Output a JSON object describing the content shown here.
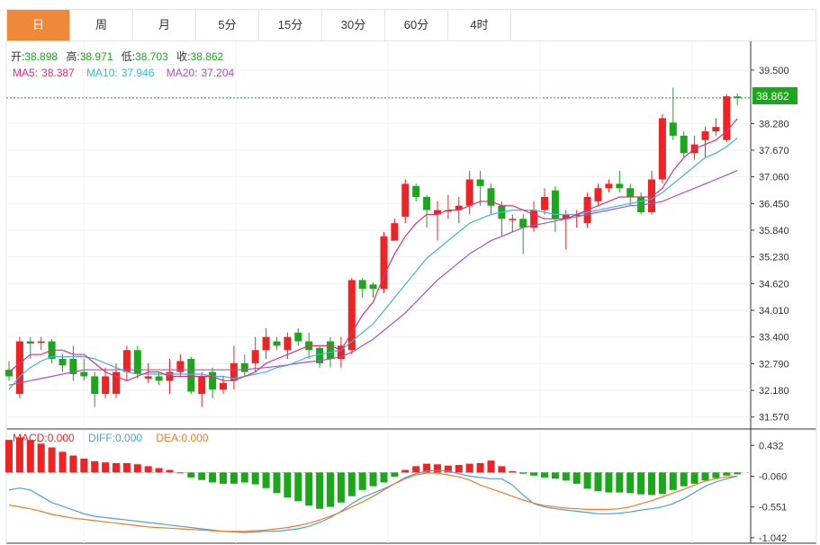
{
  "tabs": [
    "日",
    "周",
    "月",
    "5分",
    "15分",
    "30分",
    "60分",
    "4时"
  ],
  "active_tab": 0,
  "ohlc": {
    "open_label": "开:",
    "open": "38.898",
    "high_label": "高:",
    "high": "38.971",
    "low_label": "低:",
    "low": "38.703",
    "close_label": "收:",
    "close": "38.862"
  },
  "ma": {
    "ma5_label": "MA5:",
    "ma5": "38.387",
    "ma10_label": "MA10:",
    "ma10": "37.946",
    "ma20_label": "MA20:",
    "ma20": "37.204"
  },
  "macd_header": {
    "macd_label": "MACD:",
    "macd": "0.000",
    "diff_label": "DIFF:",
    "diff": "0.000",
    "dea_label": "DEA:",
    "dea": "0.000"
  },
  "last_price_tag": "38.862",
  "colors": {
    "up": "#ee2424",
    "down": "#1aa81a",
    "ma5": "#e0307a",
    "ma10": "#3bb8d8",
    "ma20": "#b050c0",
    "diff": "#4aa0e0",
    "dea": "#f07d23",
    "accent": "#f0883a"
  },
  "chart_data": [
    {
      "type": "candlestick",
      "y_ticks": [
        39.5,
        38.28,
        37.67,
        37.06,
        36.45,
        35.84,
        35.23,
        34.62,
        34.01,
        33.4,
        32.79,
        32.18,
        31.57
      ],
      "y_tick_labels": [
        "39.500",
        "38.280",
        "37.670",
        "37.060",
        "36.450",
        "35.840",
        "35.230",
        "34.620",
        "34.010",
        "33.400",
        "32.790",
        "32.180",
        "31.570"
      ],
      "ylim": [
        31.4,
        39.95
      ],
      "candles": [
        [
          32.65,
          32.5,
          32.85,
          32.4
        ],
        [
          32.1,
          33.3,
          33.4,
          32.0
        ],
        [
          33.3,
          33.25,
          33.4,
          32.9
        ],
        [
          33.3,
          33.3,
          33.4,
          33.1
        ],
        [
          33.3,
          32.9,
          33.35,
          32.8
        ],
        [
          32.9,
          32.75,
          33.0,
          32.6
        ],
        [
          32.9,
          32.55,
          33.2,
          32.4
        ],
        [
          32.6,
          32.5,
          32.9,
          32.4
        ],
        [
          32.5,
          32.1,
          32.6,
          31.8
        ],
        [
          32.1,
          32.5,
          32.7,
          32.0
        ],
        [
          32.1,
          32.6,
          32.8,
          32.0
        ],
        [
          32.6,
          33.1,
          33.2,
          32.4
        ],
        [
          33.1,
          32.55,
          33.2,
          32.45
        ],
        [
          32.45,
          32.5,
          32.8,
          32.35
        ],
        [
          32.5,
          32.4,
          32.6,
          32.3
        ],
        [
          32.4,
          32.6,
          32.9,
          32.1
        ],
        [
          32.6,
          32.85,
          33.0,
          32.5
        ],
        [
          32.9,
          32.15,
          32.95,
          32.1
        ],
        [
          32.1,
          32.5,
          32.6,
          31.8
        ],
        [
          32.6,
          32.2,
          32.7,
          32.0
        ],
        [
          32.2,
          32.35,
          32.5,
          32.1
        ],
        [
          32.4,
          32.8,
          33.2,
          32.2
        ],
        [
          32.8,
          32.6,
          33.0,
          32.5
        ],
        [
          32.8,
          33.1,
          33.4,
          32.6
        ],
        [
          33.1,
          33.4,
          33.6,
          32.9
        ],
        [
          33.3,
          33.2,
          33.4,
          33.1
        ],
        [
          33.1,
          33.4,
          33.5,
          32.9
        ],
        [
          33.5,
          33.3,
          33.6,
          33.2
        ],
        [
          33.3,
          33.1,
          33.5,
          32.9
        ],
        [
          33.15,
          32.8,
          33.2,
          32.7
        ],
        [
          33.3,
          32.9,
          33.4,
          32.7
        ],
        [
          32.9,
          33.2,
          33.4,
          32.7
        ],
        [
          33.1,
          34.7,
          34.75,
          33.0
        ],
        [
          34.7,
          34.5,
          34.75,
          34.3
        ],
        [
          34.6,
          34.5,
          34.65,
          34.3
        ],
        [
          34.5,
          35.7,
          35.8,
          34.4
        ],
        [
          35.6,
          36.0,
          36.1,
          35.6
        ],
        [
          36.15,
          36.9,
          37.0,
          36.0
        ],
        [
          36.85,
          36.6,
          36.9,
          36.5
        ],
        [
          36.6,
          36.3,
          36.65,
          35.9
        ],
        [
          36.2,
          36.3,
          36.5,
          35.6
        ],
        [
          36.3,
          36.3,
          36.65,
          36.1
        ],
        [
          36.3,
          36.4,
          36.6,
          36.0
        ],
        [
          36.4,
          37.0,
          37.2,
          36.2
        ],
        [
          37.0,
          36.85,
          37.2,
          36.4
        ],
        [
          36.8,
          36.4,
          36.9,
          36.2
        ],
        [
          36.4,
          36.1,
          36.5,
          35.7
        ],
        [
          36.1,
          36.1,
          36.2,
          35.8
        ],
        [
          36.1,
          35.9,
          36.2,
          35.3
        ],
        [
          35.9,
          36.3,
          36.5,
          35.8
        ],
        [
          36.3,
          36.6,
          36.8,
          36.2
        ],
        [
          36.75,
          36.1,
          36.85,
          35.8
        ],
        [
          36.1,
          36.2,
          36.3,
          35.4
        ],
        [
          36.2,
          36.2,
          36.3,
          35.9
        ],
        [
          36.0,
          36.6,
          36.7,
          35.9
        ],
        [
          36.5,
          36.8,
          36.9,
          36.4
        ],
        [
          36.8,
          36.9,
          37.0,
          36.7
        ],
        [
          36.9,
          36.8,
          37.2,
          36.7
        ],
        [
          36.8,
          36.6,
          36.9,
          36.4
        ],
        [
          36.6,
          36.25,
          36.7,
          36.2
        ],
        [
          36.25,
          37.0,
          37.2,
          36.2
        ],
        [
          37.0,
          38.4,
          38.5,
          36.9
        ],
        [
          38.3,
          38.0,
          39.1,
          37.9
        ],
        [
          38.0,
          37.6,
          38.1,
          37.5
        ],
        [
          37.6,
          37.8,
          38.0,
          37.45
        ],
        [
          37.9,
          38.1,
          38.2,
          37.5
        ],
        [
          38.1,
          38.2,
          38.4,
          38.0
        ],
        [
          37.9,
          38.9,
          38.95,
          37.85
        ],
        [
          38.898,
          38.862,
          38.971,
          38.703
        ]
      ],
      "ma5": [
        32.6,
        32.8,
        33.0,
        33.0,
        33.1,
        33.1,
        33.0,
        33.0,
        32.8,
        32.6,
        32.5,
        32.4,
        32.5,
        32.6,
        32.6,
        32.5,
        32.5,
        32.5,
        32.5,
        32.5,
        32.4,
        32.4,
        32.5,
        32.6,
        32.8,
        32.9,
        33.0,
        33.1,
        33.2,
        33.2,
        33.2,
        33.1,
        33.5,
        33.9,
        34.2,
        34.8,
        35.3,
        35.7,
        36.0,
        36.2,
        36.2,
        36.3,
        36.3,
        36.4,
        36.5,
        36.5,
        36.4,
        36.4,
        36.3,
        36.2,
        36.1,
        36.1,
        36.1,
        36.2,
        36.3,
        36.4,
        36.5,
        36.6,
        36.6,
        36.6,
        36.6,
        36.8,
        37.2,
        37.5,
        37.7,
        37.8,
        37.9,
        38.1,
        38.387
      ],
      "ma10": [
        32.2,
        32.5,
        32.7,
        32.85,
        32.95,
        32.95,
        32.95,
        32.95,
        32.9,
        32.8,
        32.7,
        32.6,
        32.55,
        32.55,
        32.55,
        32.55,
        32.55,
        32.55,
        32.55,
        32.5,
        32.5,
        32.45,
        32.5,
        32.55,
        32.6,
        32.7,
        32.75,
        32.85,
        32.95,
        33.0,
        33.05,
        33.1,
        33.3,
        33.5,
        33.7,
        34.0,
        34.3,
        34.6,
        34.9,
        35.2,
        35.4,
        35.6,
        35.8,
        36.0,
        36.1,
        36.2,
        36.25,
        36.3,
        36.3,
        36.3,
        36.25,
        36.2,
        36.2,
        36.2,
        36.25,
        36.3,
        36.35,
        36.4,
        36.45,
        36.5,
        36.55,
        36.7,
        36.9,
        37.1,
        37.3,
        37.5,
        37.6,
        37.75,
        37.946
      ],
      "ma20": [
        32.3,
        32.35,
        32.4,
        32.45,
        32.5,
        32.55,
        32.6,
        32.65,
        32.65,
        32.65,
        32.65,
        32.65,
        32.65,
        32.65,
        32.65,
        32.65,
        32.65,
        32.65,
        32.65,
        32.65,
        32.65,
        32.65,
        32.65,
        32.68,
        32.7,
        32.73,
        32.76,
        32.8,
        32.83,
        32.86,
        32.9,
        32.95,
        33.05,
        33.2,
        33.35,
        33.55,
        33.75,
        33.95,
        34.2,
        34.45,
        34.7,
        34.9,
        35.1,
        35.3,
        35.45,
        35.6,
        35.7,
        35.8,
        35.9,
        35.95,
        36.0,
        36.05,
        36.1,
        36.15,
        36.2,
        36.25,
        36.3,
        36.35,
        36.4,
        36.42,
        36.45,
        36.5,
        36.6,
        36.7,
        36.8,
        36.9,
        37.0,
        37.1,
        37.204
      ]
    },
    {
      "type": "bar",
      "name": "MACD",
      "y_ticks": [
        0.432,
        -0.06,
        -0.551,
        -1.042
      ],
      "y_tick_labels": [
        "0.432",
        "-0.060",
        "-0.551",
        "-1.042"
      ],
      "ylim": [
        -1.13,
        0.68
      ],
      "histogram": [
        0.52,
        0.56,
        0.52,
        0.46,
        0.4,
        0.33,
        0.27,
        0.22,
        0.18,
        0.16,
        0.15,
        0.15,
        0.13,
        0.1,
        0.07,
        0.04,
        0.0,
        -0.08,
        -0.12,
        -0.16,
        -0.18,
        -0.18,
        -0.16,
        -0.19,
        -0.25,
        -0.33,
        -0.4,
        -0.46,
        -0.53,
        -0.58,
        -0.55,
        -0.48,
        -0.38,
        -0.28,
        -0.22,
        -0.16,
        -0.07,
        0.04,
        0.1,
        0.14,
        0.13,
        0.11,
        0.12,
        0.14,
        0.15,
        0.19,
        0.1,
        0.02,
        -0.02,
        -0.05,
        -0.08,
        -0.1,
        -0.13,
        -0.18,
        -0.26,
        -0.3,
        -0.32,
        -0.32,
        -0.33,
        -0.35,
        -0.36,
        -0.34,
        -0.28,
        -0.22,
        -0.18,
        -0.13,
        -0.09,
        -0.05,
        -0.03
      ],
      "diff": [
        -0.28,
        -0.25,
        -0.28,
        -0.38,
        -0.48,
        -0.54,
        -0.6,
        -0.66,
        -0.7,
        -0.72,
        -0.74,
        -0.76,
        -0.78,
        -0.8,
        -0.82,
        -0.84,
        -0.86,
        -0.88,
        -0.9,
        -0.92,
        -0.94,
        -0.95,
        -0.96,
        -0.95,
        -0.94,
        -0.94,
        -0.92,
        -0.9,
        -0.86,
        -0.8,
        -0.72,
        -0.62,
        -0.5,
        -0.4,
        -0.33,
        -0.26,
        -0.18,
        -0.08,
        -0.02,
        0.02,
        0.03,
        0.02,
        -0.02,
        -0.06,
        -0.08,
        -0.1,
        -0.1,
        -0.2,
        -0.36,
        -0.5,
        -0.55,
        -0.58,
        -0.6,
        -0.62,
        -0.64,
        -0.66,
        -0.66,
        -0.65,
        -0.63,
        -0.6,
        -0.58,
        -0.55,
        -0.5,
        -0.42,
        -0.32,
        -0.22,
        -0.15,
        -0.1,
        -0.06
      ],
      "dea": [
        -0.52,
        -0.55,
        -0.58,
        -0.62,
        -0.67,
        -0.7,
        -0.73,
        -0.75,
        -0.77,
        -0.79,
        -0.81,
        -0.83,
        -0.85,
        -0.87,
        -0.88,
        -0.89,
        -0.9,
        -0.91,
        -0.92,
        -0.93,
        -0.94,
        -0.94,
        -0.94,
        -0.93,
        -0.92,
        -0.9,
        -0.88,
        -0.85,
        -0.81,
        -0.76,
        -0.7,
        -0.63,
        -0.55,
        -0.47,
        -0.38,
        -0.28,
        -0.18,
        -0.1,
        -0.04,
        -0.01,
        -0.01,
        -0.04,
        -0.07,
        -0.12,
        -0.2,
        -0.26,
        -0.32,
        -0.38,
        -0.44,
        -0.49,
        -0.53,
        -0.55,
        -0.57,
        -0.58,
        -0.59,
        -0.59,
        -0.59,
        -0.58,
        -0.55,
        -0.5,
        -0.45,
        -0.39,
        -0.33,
        -0.27,
        -0.2,
        -0.14,
        -0.1,
        -0.07,
        -0.06
      ]
    }
  ]
}
